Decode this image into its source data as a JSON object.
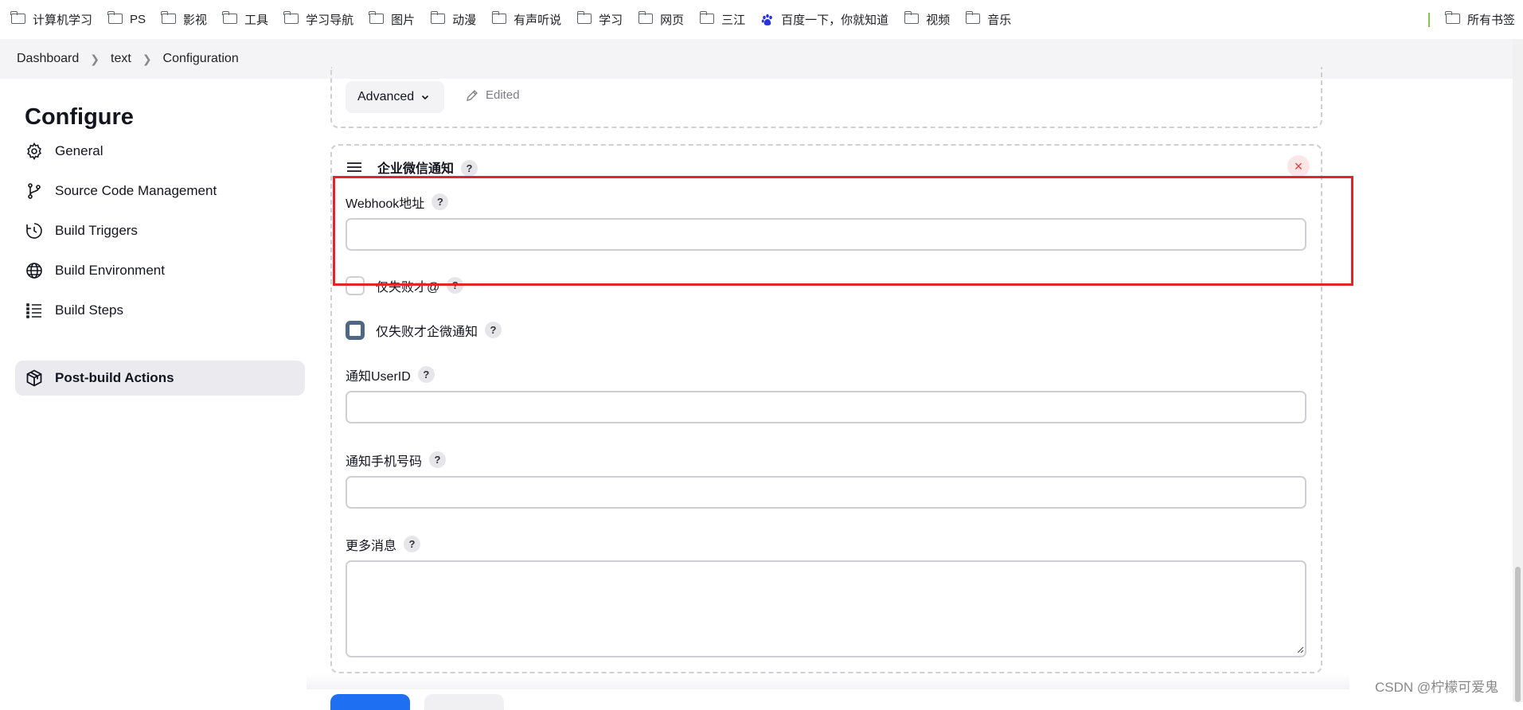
{
  "bookmarks": {
    "items": [
      {
        "label": "计算机学习",
        "icon": "folder-icon"
      },
      {
        "label": "PS",
        "icon": "folder-icon"
      },
      {
        "label": "影视",
        "icon": "folder-icon"
      },
      {
        "label": "工具",
        "icon": "folder-icon"
      },
      {
        "label": "学习导航",
        "icon": "folder-icon"
      },
      {
        "label": "图片",
        "icon": "folder-icon"
      },
      {
        "label": "动漫",
        "icon": "folder-icon"
      },
      {
        "label": "有声听说",
        "icon": "folder-icon"
      },
      {
        "label": "学习",
        "icon": "folder-icon"
      },
      {
        "label": "网页",
        "icon": "folder-icon"
      },
      {
        "label": "三江",
        "icon": "folder-icon"
      },
      {
        "label": "百度一下，你就知道",
        "icon": "baidu-paw-icon"
      },
      {
        "label": "视频",
        "icon": "folder-icon"
      },
      {
        "label": "音乐",
        "icon": "folder-icon"
      }
    ],
    "all_bookmarks": "所有书签"
  },
  "breadcrumb": [
    "Dashboard",
    "text",
    "Configuration"
  ],
  "sidebar": {
    "title": "Configure",
    "items": [
      {
        "label": "General",
        "icon": "gear-icon"
      },
      {
        "label": "Source Code Management",
        "icon": "branch-icon"
      },
      {
        "label": "Build Triggers",
        "icon": "clock-icon"
      },
      {
        "label": "Build Environment",
        "icon": "globe-icon"
      },
      {
        "label": "Build Steps",
        "icon": "list-icon"
      },
      {
        "label": "Post-build Actions",
        "icon": "cube-icon",
        "active": true
      }
    ]
  },
  "main": {
    "advanced_label": "Advanced",
    "edited_label": "Edited",
    "section_title": "企业微信通知",
    "help_glyph": "?",
    "close_glyph": "×",
    "fields": {
      "webhook_label": "Webhook地址",
      "webhook_value": "",
      "fail_at_label": "仅失败才@",
      "fail_at_checked": false,
      "fail_notify_label": "仅失败才企微通知",
      "fail_notify_checked": true,
      "userid_label": "通知UserID",
      "userid_value": "",
      "phone_label": "通知手机号码",
      "phone_value": "",
      "more_label": "更多消息",
      "more_value": ""
    }
  },
  "watermark": "CSDN @柠檬可爱鬼",
  "colors": {
    "highlight": "#e3242b",
    "accent": "#1f6ff3",
    "checked": "#4f6784"
  }
}
